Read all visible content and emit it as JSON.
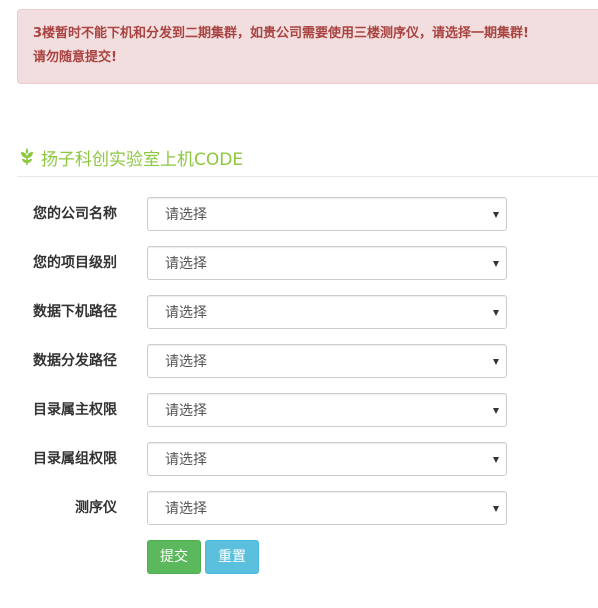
{
  "alert": {
    "line1": "3楼暂时不能下机和分发到二期集群，如贵公司需要使用三楼测序仪，请选择一期集群!",
    "line2": "请勿随意提交!"
  },
  "section": {
    "icon": "leaf-icon",
    "title": "扬子科创实验室上机CODE"
  },
  "form": {
    "fields": [
      {
        "label": "您的公司名称",
        "value": "请选择"
      },
      {
        "label": "您的项目级别",
        "value": "请选择"
      },
      {
        "label": "数据下机路径",
        "value": "请选择"
      },
      {
        "label": "数据分发路径",
        "value": "请选择"
      },
      {
        "label": "目录属主权限",
        "value": "请选择"
      },
      {
        "label": "目录属组权限",
        "value": "请选择"
      },
      {
        "label": "测序仪",
        "value": "请选择"
      }
    ],
    "submit_label": "提交",
    "reset_label": "重置"
  },
  "colors": {
    "alert_bg": "#f2dede",
    "alert_text": "#a94442",
    "title_green": "#8dc63f",
    "submit_green": "#5cb85c",
    "reset_blue": "#5bc0de"
  }
}
